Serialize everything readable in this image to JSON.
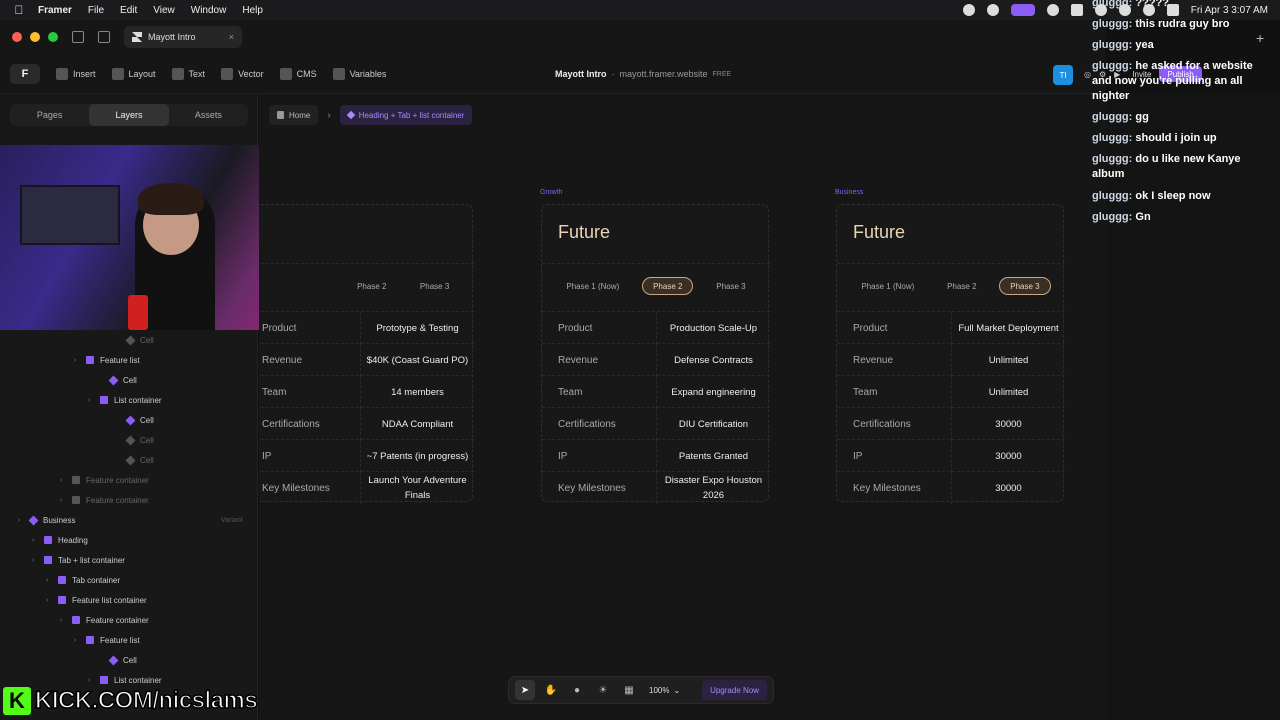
{
  "menubar": {
    "app": "Framer",
    "items": [
      "File",
      "Edit",
      "View",
      "Window",
      "Help"
    ],
    "clock": "Fri Apr 3  3:07 AM"
  },
  "titlebar": {
    "tab_title": "Mayott Intro"
  },
  "toolbar": {
    "tools": [
      "Insert",
      "Layout",
      "Text",
      "Vector",
      "CMS",
      "Variables"
    ],
    "project_name": "Mayott Intro",
    "domain": "mayott.framer.website",
    "plan_badge": "FREE",
    "avatar_initials": "TI",
    "invite_label": "Invite",
    "publish_label": "Publish"
  },
  "left_panel": {
    "tabs": [
      "Pages",
      "Layers",
      "Assets"
    ],
    "active_tab": "Layers",
    "layers": [
      {
        "label": "Cell",
        "type": "component",
        "dim": true
      },
      {
        "label": "Feature list",
        "type": "frame",
        "dim": false
      },
      {
        "label": "Cell",
        "type": "component",
        "dim": false
      },
      {
        "label": "List container",
        "type": "frame",
        "dim": false
      },
      {
        "label": "Cell",
        "type": "component",
        "dim": false
      },
      {
        "label": "Cell",
        "type": "component",
        "dim": true
      },
      {
        "label": "Cell",
        "type": "component",
        "dim": true
      },
      {
        "label": "Feature container",
        "type": "frame",
        "dim": true
      },
      {
        "label": "Feature container",
        "type": "frame",
        "dim": true
      },
      {
        "label": "Business",
        "type": "component",
        "dim": false,
        "badge": "Variant"
      },
      {
        "label": "Heading",
        "type": "frame",
        "dim": false
      },
      {
        "label": "Tab + list container",
        "type": "frame",
        "dim": false
      },
      {
        "label": "Tab container",
        "type": "frame",
        "dim": false
      },
      {
        "label": "Feature list container",
        "type": "frame",
        "dim": false
      },
      {
        "label": "Feature container",
        "type": "frame",
        "dim": false
      },
      {
        "label": "Feature list",
        "type": "frame",
        "dim": false
      },
      {
        "label": "Cell",
        "type": "component",
        "dim": false
      },
      {
        "label": "List container",
        "type": "frame",
        "dim": false
      }
    ]
  },
  "canvas": {
    "breadcrumb": {
      "home": "Home",
      "current": "Heading + Tab + list container"
    },
    "frame_labels": {
      "growth": "Growth",
      "business": "Business"
    },
    "phases": [
      "Phase 1 (Now)",
      "Phase 2",
      "Phase 3"
    ],
    "cards": [
      {
        "title": "",
        "selected_phase": "",
        "rows": [
          {
            "key": "Product",
            "value": "Prototype & Testing"
          },
          {
            "key": "Revenue",
            "value": "$40K (Coast Guard PO)"
          },
          {
            "key": "Team",
            "value": "14 members"
          },
          {
            "key": "Certifications",
            "value": "NDAA Compliant"
          },
          {
            "key": "IP",
            "value": "~7 Patents (in progress)"
          },
          {
            "key": "Key Milestones",
            "value": "Launch Your Adventure Finals"
          }
        ]
      },
      {
        "title": "Future",
        "selected_phase": "Phase 2",
        "rows": [
          {
            "key": "Product",
            "value": "Production Scale-Up"
          },
          {
            "key": "Revenue",
            "value": "Defense Contracts"
          },
          {
            "key": "Team",
            "value": "Expand engineering"
          },
          {
            "key": "Certifications",
            "value": "DIU Certification"
          },
          {
            "key": "IP",
            "value": "Patents Granted"
          },
          {
            "key": "Key Milestones",
            "value": "Disaster Expo Houston 2026"
          }
        ]
      },
      {
        "title": "Future",
        "selected_phase": "Phase 3",
        "rows": [
          {
            "key": "Product",
            "value": "Full Market Deployment"
          },
          {
            "key": "Revenue",
            "value": "Unlimited"
          },
          {
            "key": "Team",
            "value": "Unlimited"
          },
          {
            "key": "Certifications",
            "value": "30000"
          },
          {
            "key": "IP",
            "value": "30000"
          },
          {
            "key": "Key Milestones",
            "value": "30000"
          }
        ]
      }
    ]
  },
  "bottom_toolbar": {
    "zoom": "100%",
    "upgrade_label": "Upgrade Now"
  },
  "chat": {
    "messages": [
      {
        "user": "gluggg:",
        "text": "?????"
      },
      {
        "user": "gluggg:",
        "text": "this rudra guy bro"
      },
      {
        "user": "gluggg:",
        "text": "yea"
      },
      {
        "user": "gluggg:",
        "text": "he asked for a website and now you're pulling an all nighter"
      },
      {
        "user": "gluggg:",
        "text": "gg"
      },
      {
        "user": "gluggg:",
        "text": "should i join up"
      },
      {
        "user": "gluggg:",
        "text": "do u like new Kanye album"
      },
      {
        "user": "gluggg:",
        "text": "ok I sleep now"
      },
      {
        "user": "gluggg:",
        "text": "Gn"
      }
    ]
  },
  "overlay": {
    "kick_url": "KICK.COM/nicslams"
  },
  "colors": {
    "accent": "#8b5cf6",
    "title_tan": "#e8d5b5",
    "kick_green": "#53fc18"
  }
}
